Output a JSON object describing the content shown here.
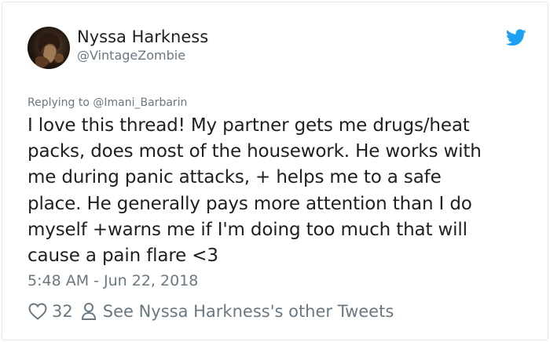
{
  "author": {
    "display_name": "Nyssa Harkness",
    "handle": "@VintageZombie",
    "avatar_icon": "user-avatar"
  },
  "brand": {
    "icon": "twitter-bird-icon",
    "color": "#1da1f2"
  },
  "tweet": {
    "replying_prefix": "Replying to ",
    "replying_to": "@Imani_Barbarin",
    "lines": [
      "I love this thread! My partner gets me drugs/heat",
      "packs, does most of the housework. He works with",
      "me during panic attacks, + helps me to a safe",
      "place. He generally pays more attention than I do",
      "myself +warns me if I'm doing too much that will",
      "cause a pain flare <3"
    ],
    "timestamp": "5:48 AM - Jun 22, 2018"
  },
  "actions": {
    "like_icon": "heart-icon",
    "like_count": "32",
    "profile_icon": "person-icon",
    "other_tweets_label": "See Nyssa Harkness's other Tweets"
  },
  "colors": {
    "text": "#1c2022",
    "muted": "#697882",
    "border": "#e1e8ed",
    "link": "#697882"
  }
}
